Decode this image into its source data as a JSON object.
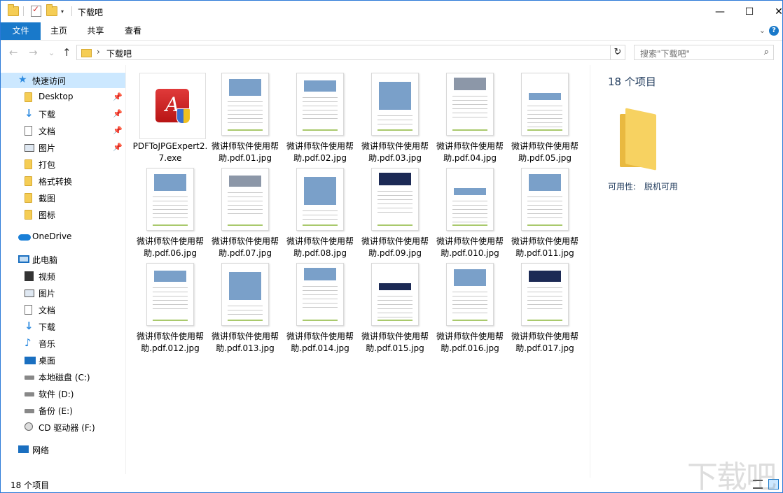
{
  "window": {
    "title": "下载吧",
    "minimize": "—",
    "maximize": "☐",
    "close": "✕"
  },
  "ribbon": {
    "tabs": [
      "文件",
      "主页",
      "共享",
      "查看"
    ],
    "expand": "⌄",
    "help": "?"
  },
  "address": {
    "back": "←",
    "forward": "→",
    "recent": "⌄",
    "up": "↑",
    "chevron": "›",
    "path": "下载吧",
    "dropdown": "⌄",
    "refresh": "↻",
    "search_placeholder": "搜索\"下载吧\"",
    "search_icon": "⌕"
  },
  "sidebar": {
    "pin_glyph": "📌",
    "items": [
      {
        "label": "快速访问",
        "icon": "star-icon",
        "glyph": "★"
      },
      {
        "label": "Desktop",
        "icon": "folder-icon",
        "pinned": true
      },
      {
        "label": "下载",
        "icon": "download-icon",
        "glyph": "↓",
        "pinned": true
      },
      {
        "label": "文档",
        "icon": "document-icon",
        "pinned": true
      },
      {
        "label": "图片",
        "icon": "pictures-icon",
        "pinned": true
      },
      {
        "label": "打包",
        "icon": "folder-icon"
      },
      {
        "label": "格式转换",
        "icon": "folder-icon"
      },
      {
        "label": "截图",
        "icon": "folder-icon"
      },
      {
        "label": "图标",
        "icon": "folder-icon"
      },
      {
        "label": "OneDrive",
        "icon": "cloud-icon"
      },
      {
        "label": "此电脑",
        "icon": "computer-icon"
      },
      {
        "label": "视频",
        "icon": "video-icon"
      },
      {
        "label": "图片",
        "icon": "pictures-icon"
      },
      {
        "label": "文档",
        "icon": "document-icon"
      },
      {
        "label": "下载",
        "icon": "download-icon",
        "glyph": "↓"
      },
      {
        "label": "音乐",
        "icon": "music-icon",
        "glyph": "♪"
      },
      {
        "label": "桌面",
        "icon": "desktop-icon"
      },
      {
        "label": "本地磁盘 (C:)",
        "icon": "drive-icon"
      },
      {
        "label": "软件 (D:)",
        "icon": "drive-icon"
      },
      {
        "label": "备份 (E:)",
        "icon": "drive-icon"
      },
      {
        "label": "CD 驱动器 (F:)",
        "icon": "cd-drive-icon"
      },
      {
        "label": "网络",
        "icon": "network-icon"
      }
    ]
  },
  "files": [
    {
      "name": "PDFToJPGExpert2.7.exe",
      "type": "exe"
    },
    {
      "name": "微讲师软件使用帮助.pdf.01.jpg",
      "type": "jpg"
    },
    {
      "name": "微讲师软件使用帮助.pdf.02.jpg",
      "type": "jpg"
    },
    {
      "name": "微讲师软件使用帮助.pdf.03.jpg",
      "type": "jpg"
    },
    {
      "name": "微讲师软件使用帮助.pdf.04.jpg",
      "type": "jpg"
    },
    {
      "name": "微讲师软件使用帮助.pdf.05.jpg",
      "type": "jpg"
    },
    {
      "name": "微讲师软件使用帮助.pdf.06.jpg",
      "type": "jpg"
    },
    {
      "name": "微讲师软件使用帮助.pdf.07.jpg",
      "type": "jpg"
    },
    {
      "name": "微讲师软件使用帮助.pdf.08.jpg",
      "type": "jpg"
    },
    {
      "name": "微讲师软件使用帮助.pdf.09.jpg",
      "type": "jpg"
    },
    {
      "name": "微讲师软件使用帮助.pdf.010.jpg",
      "type": "jpg"
    },
    {
      "name": "微讲师软件使用帮助.pdf.011.jpg",
      "type": "jpg"
    },
    {
      "name": "微讲师软件使用帮助.pdf.012.jpg",
      "type": "jpg"
    },
    {
      "name": "微讲师软件使用帮助.pdf.013.jpg",
      "type": "jpg"
    },
    {
      "name": "微讲师软件使用帮助.pdf.014.jpg",
      "type": "jpg"
    },
    {
      "name": "微讲师软件使用帮助.pdf.015.jpg",
      "type": "jpg"
    },
    {
      "name": "微讲师软件使用帮助.pdf.016.jpg",
      "type": "jpg"
    },
    {
      "name": "微讲师软件使用帮助.pdf.017.jpg",
      "type": "jpg"
    }
  ],
  "details": {
    "count": "18 个项目",
    "availability_label": "可用性:",
    "availability_value": "脱机可用"
  },
  "status": {
    "count": "18 个项目"
  },
  "watermark": "下载吧",
  "colors": {
    "accent": "#1979ca",
    "selection": "#cce8ff",
    "folder": "#f5cd55"
  }
}
